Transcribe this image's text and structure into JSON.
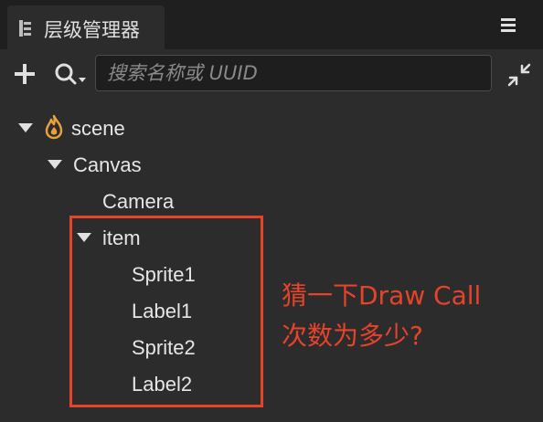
{
  "panel": {
    "title": "层级管理器",
    "icons": {
      "title": "hierarchy-icon",
      "menu": "menu-icon",
      "add": "plus-icon",
      "search_type": "search-icon",
      "collapse": "collapse-icon",
      "scene": "flame-icon"
    }
  },
  "toolbar": {
    "search_placeholder": "搜索名称或 UUID",
    "search_value": ""
  },
  "tree": {
    "scene": "scene",
    "canvas": "Canvas",
    "camera": "Camera",
    "item": "item",
    "sprite1": "Sprite1",
    "label1": "Label1",
    "sprite2": "Sprite2",
    "label2": "Label2"
  },
  "annotation": {
    "line1": "猜一下Draw Call",
    "line2": "次数为多少?"
  },
  "colors": {
    "annotation": "#e5432a",
    "scene_icon": "#e8a13a",
    "background": "#2c2c2c",
    "text": "#e6e6e6"
  }
}
